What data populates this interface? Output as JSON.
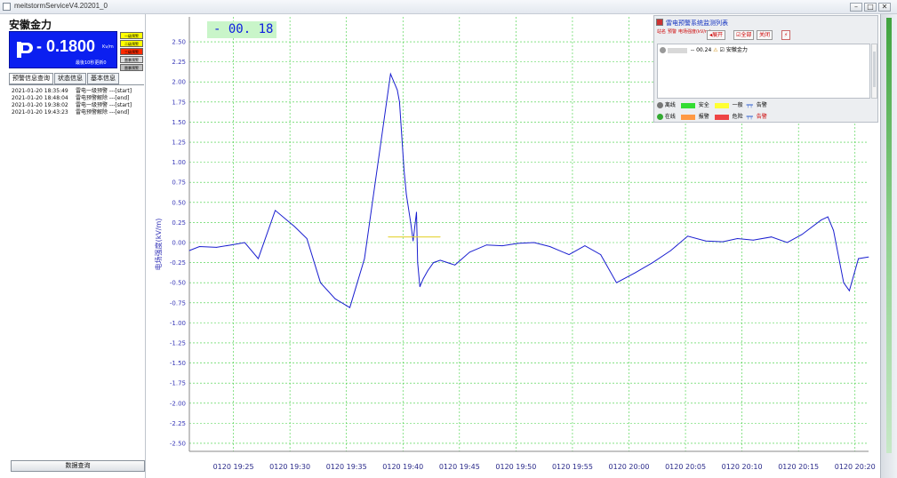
{
  "window": {
    "title": "meitstormServiceV4.20201_0",
    "min": "–",
    "max": "□",
    "close": "✕"
  },
  "station": {
    "name": "安徽金力",
    "value": "- 0.1800",
    "unit": "Kv/m",
    "sub_label": "最後10秒更新0"
  },
  "levels": [
    "一级预警",
    "二级预警",
    "三级预警",
    "雷暴预警",
    "雷暴预警"
  ],
  "levels_colors": [
    "#ffff00",
    "#ffff00",
    "#ff2a00",
    "#dcdcdc",
    "#bdbdbd"
  ],
  "tabs": [
    "预警信息查询",
    "状态信息",
    "基本信息"
  ],
  "events": [
    {
      "time": "2021-01-20 18:35:49",
      "text": "雷电一级预警 ---[start]"
    },
    {
      "time": "2021-01-20 18:48:04",
      "text": "雷电预警解除 ---[end]"
    },
    {
      "time": "2021-01-20 19:38:02",
      "text": "雷电一级预警 ---[start]"
    },
    {
      "time": "2021-01-20 19:43:23",
      "text": "雷电预警解除 ---[end]"
    }
  ],
  "query_button": "数据查询",
  "current_reading": "- 00. 18",
  "legend_window": {
    "title": "雷电预警系统监测列表",
    "head_cols": [
      "站名",
      "预警",
      "电场强度(kV/m)"
    ],
    "btn_open": "展开",
    "btn_all": "全部",
    "btn_close": "关闭",
    "row_value": "-- 00.24",
    "row_station": "安徽金力",
    "legend_offline": "离线",
    "legend_safe": "安全",
    "legend_normal": "一般",
    "legend_alarm": "告警",
    "legend_online": "在线",
    "legend_warn": "报警",
    "legend_danger": "危险",
    "legend_alarm2": "告警",
    "colors": {
      "safe": "#33dd33",
      "normal": "#ffff33",
      "warn": "#ff9944",
      "danger": "#ee4444",
      "blue": "#3060d0"
    }
  },
  "chart_data": {
    "type": "line",
    "ylabel": "电场强度(kV/m)",
    "ylim": [
      -2.6,
      2.6
    ],
    "y_ticks": [
      "2.50",
      "2.25",
      "2.00",
      "1.75",
      "1.50",
      "1.25",
      "1.00",
      "0.75",
      "0.50",
      "0.25",
      "0.00",
      "-0.25",
      "-0.50",
      "-0.75",
      "-1.00",
      "-1.25",
      "-1.50",
      "-1.75",
      "-2.00",
      "-2.25",
      "-2.50"
    ],
    "y_tick_values": [
      2.5,
      2.25,
      2.0,
      1.75,
      1.5,
      1.25,
      1.0,
      0.75,
      0.5,
      0.25,
      0.0,
      -0.25,
      -0.5,
      -0.75,
      -1.0,
      -1.25,
      -1.5,
      -1.75,
      -2.0,
      -2.25,
      -2.5
    ],
    "x_ticks": [
      "0120 19:25",
      "0120 19:30",
      "0120 19:35",
      "0120 19:40",
      "0120 19:45",
      "0120 19:50",
      "0120 19:55",
      "0120 20:00",
      "0120 20:05",
      "0120 20:10",
      "0120 20:15",
      "0120 20:20"
    ],
    "x_tick_minutes": [
      25,
      30,
      35,
      40,
      45,
      50,
      55,
      60,
      65,
      70,
      75,
      80
    ],
    "xlim_minutes": [
      21.1,
      81.2
    ],
    "series": [
      {
        "color": "#1a1fd0",
        "x": [
          21.1,
          22.0,
          23.5,
          24.8,
          26.0,
          27.2,
          28.7,
          30.4,
          31.5,
          32.7,
          34.0,
          35.3,
          36.6,
          37.8,
          38.9,
          39.2,
          39.5,
          39.7,
          40.1,
          40.3,
          40.7,
          40.9,
          41.2,
          41.3,
          41.5,
          41.8,
          42.2,
          42.7,
          43.3,
          44.6,
          45.9,
          47.4,
          48.8,
          50.2,
          51.6,
          53.0,
          54.7,
          56.1,
          57.5,
          58.9,
          60.5,
          62.1,
          63.7,
          65.2,
          66.8,
          68.3,
          69.6,
          71.0,
          72.6,
          74.0,
          75.3,
          77.0,
          77.6,
          78.1,
          79.0,
          79.5,
          80.3,
          81.2
        ],
        "y": [
          -0.1,
          -0.05,
          -0.06,
          -0.03,
          0.0,
          -0.2,
          0.4,
          0.2,
          0.05,
          -0.5,
          -0.7,
          -0.81,
          -0.2,
          1.0,
          2.1,
          2.0,
          1.9,
          1.75,
          0.9,
          0.6,
          0.23,
          0.02,
          0.38,
          -0.25,
          -0.55,
          -0.45,
          -0.35,
          -0.25,
          -0.22,
          -0.28,
          -0.12,
          -0.03,
          -0.04,
          -0.01,
          0.0,
          -0.05,
          -0.15,
          -0.04,
          -0.15,
          -0.5,
          -0.38,
          -0.25,
          -0.1,
          0.08,
          0.02,
          0.01,
          0.05,
          0.03,
          0.07,
          0.0,
          0.1,
          0.28,
          0.32,
          0.15,
          -0.5,
          -0.6,
          -0.2,
          -0.18
        ]
      },
      {
        "color": "#e5d233",
        "x": [
          38.7,
          43.3
        ],
        "y": [
          0.07,
          0.07
        ]
      }
    ],
    "grid": true
  }
}
